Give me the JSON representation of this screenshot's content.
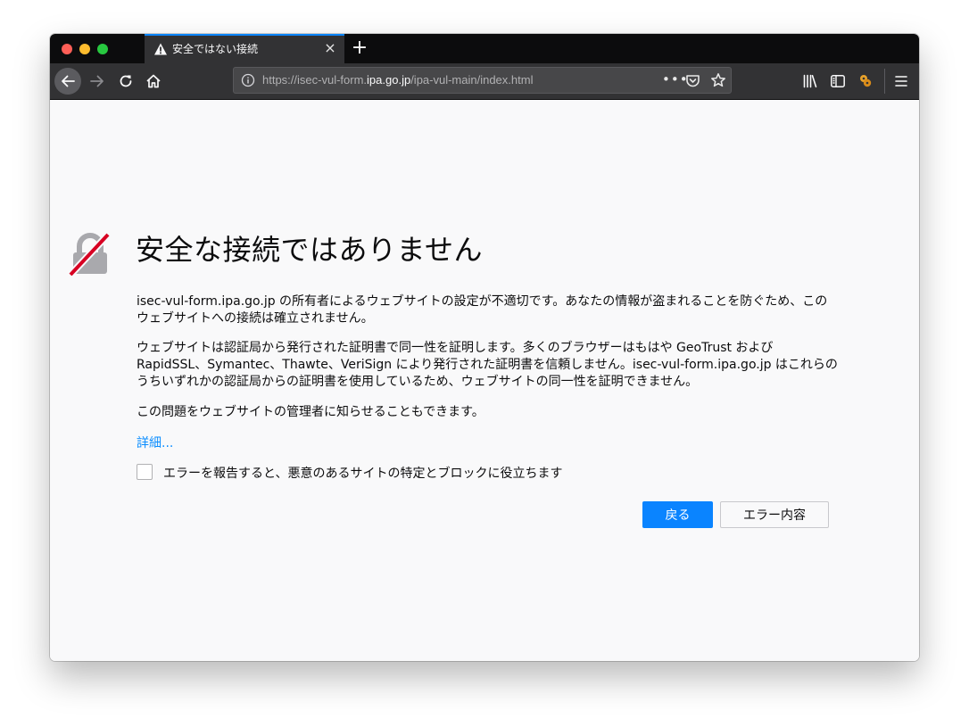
{
  "tab": {
    "title": "安全ではない接続",
    "close": "×"
  },
  "new_tab": "+",
  "url": {
    "prefix": "https://isec-vul-form.",
    "domain": "ipa.go.jp",
    "suffix": "/ipa-vul-main/index.html"
  },
  "page_actions_label": "•••",
  "icons": {
    "tab_status": "warning-icon",
    "back": "back-arrow-icon",
    "forward": "forward-arrow-icon",
    "reload": "reload-icon",
    "home": "home-icon",
    "site_info": "info-icon",
    "pocket": "pocket-icon",
    "bookmark": "star-icon",
    "library": "library-icon",
    "sidebar": "sidebar-icon",
    "extension": "extension-icon",
    "menu": "hamburger-menu-icon",
    "error": "broken-lock-icon"
  },
  "colors": {
    "accent": "#0a84ff",
    "link": "#0a8dff",
    "warning_slash": "#d70022"
  },
  "error_page": {
    "title": "安全な接続ではありません",
    "p1": "isec-vul-form.ipa.go.jp の所有者によるウェブサイトの設定が不適切です。あなたの情報が盗まれることを防ぐため、このウェブサイトへの接続は確立されません。",
    "p2": "ウェブサイトは認証局から発行された証明書で同一性を証明します。多くのブラウザーはもはや GeoTrust および RapidSSL、Symantec、Thawte、VeriSign により発行された証明書を信頼しません。isec-vul-form.ipa.go.jp はこれらのうちいずれかの認証局からの証明書を使用しているため、ウェブサイトの同一性を証明できません。",
    "p3": "この問題をウェブサイトの管理者に知らせることもできます。",
    "details_link": "詳細...",
    "report_checkbox_label": "エラーを報告すると、悪意のあるサイトの特定とブロックに役立ちます",
    "report_checked": false,
    "back_button": "戻る",
    "error_details_button": "エラー内容"
  }
}
